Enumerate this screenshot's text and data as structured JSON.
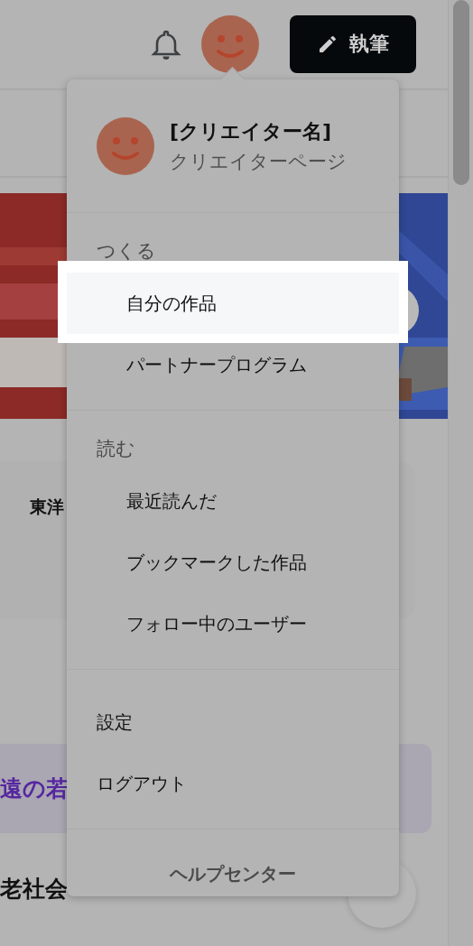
{
  "header": {
    "write_button": "執筆"
  },
  "background": {
    "card_title": "東洋",
    "highlight_text": "遠の若",
    "heading": "老社会"
  },
  "menu": {
    "name": "[クリエイター名]",
    "subtitle": "クリエイターページ",
    "sections": [
      {
        "title": "つくる",
        "items": [
          {
            "label": "自分の作品",
            "selected": true
          },
          {
            "label": "パートナープログラム",
            "selected": false
          }
        ]
      },
      {
        "title": "読む",
        "items": [
          {
            "label": "最近読んだ",
            "selected": false
          },
          {
            "label": "ブックマークした作品",
            "selected": false
          },
          {
            "label": "フォロー中のユーザー",
            "selected": false
          }
        ]
      },
      {
        "items": [
          {
            "label": "設定",
            "selected": false
          },
          {
            "label": "ログアウト",
            "selected": false
          }
        ]
      }
    ],
    "footer": "ヘルプセンター"
  }
}
